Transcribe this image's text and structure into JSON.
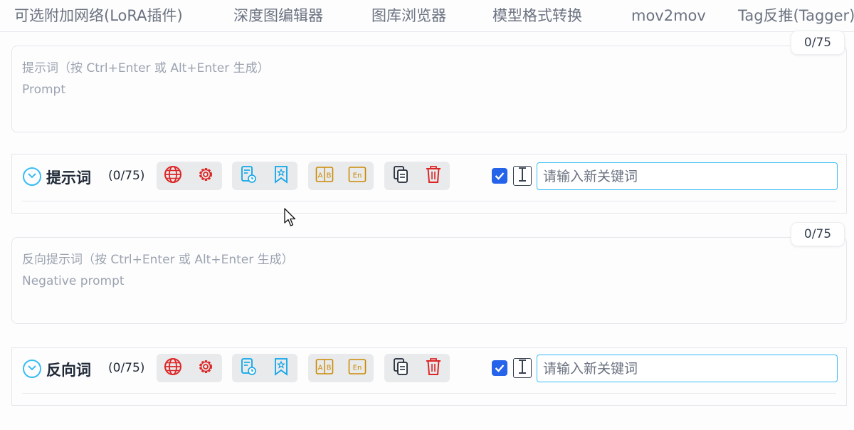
{
  "tabs": [
    {
      "label": "可选附加网络(LoRA插件)"
    },
    {
      "label": "深度图编辑器"
    },
    {
      "label": "图库浏览器"
    },
    {
      "label": "模型格式转换"
    },
    {
      "label": "mov2mov"
    },
    {
      "label": "Tag反推(Tagger)"
    }
  ],
  "positive": {
    "counter": "0/75",
    "placeholder": "提示词（按 Ctrl+Enter 或 Alt+Enter 生成）\nPrompt",
    "title": "提示词",
    "count": "(0/75)",
    "keyword_placeholder": "请输入新关键词",
    "checkbox_checked": true
  },
  "negative": {
    "counter": "0/75",
    "placeholder": "反向提示词（按 Ctrl+Enter 或 Alt+Enter 生成）\nNegative prompt",
    "title": "反向词",
    "count": "(0/75)",
    "keyword_placeholder": "请输入新关键词",
    "checkbox_checked": true
  },
  "icons": [
    "chevron-circle-icon",
    "globe-icon",
    "gear-icon",
    "history-icon",
    "bookmark-icon",
    "translate-ab-icon",
    "english-icon",
    "copy-icon",
    "trash-icon",
    "checkbox-icon",
    "text-cursor-icon"
  ],
  "colors": {
    "accent": "#38bdf8",
    "red": "#dc2626",
    "gold": "#ca8a04",
    "checkbox": "#2563eb"
  }
}
